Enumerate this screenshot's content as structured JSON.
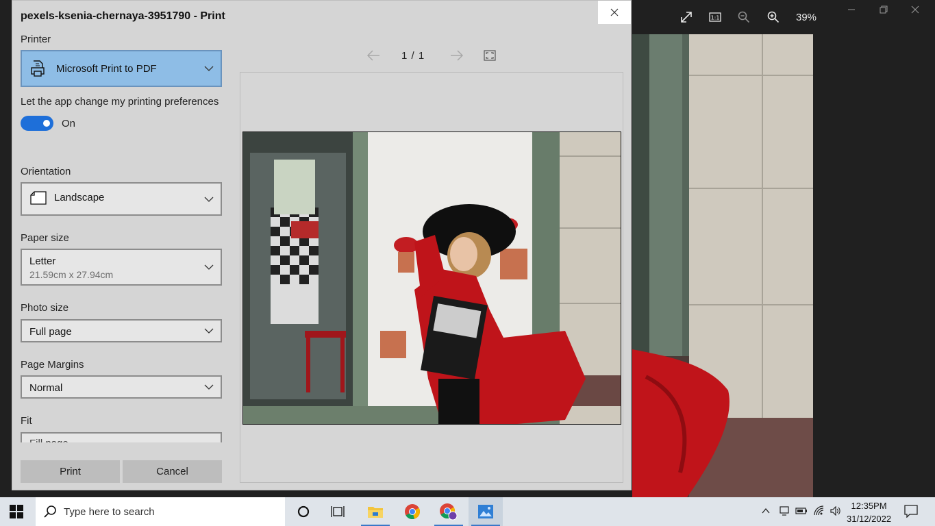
{
  "photos_app": {
    "zoom": "39%",
    "toolbar_icons": [
      "expand-icon",
      "actual-size-icon",
      "zoom-out-icon",
      "zoom-in-icon"
    ],
    "window_controls": [
      "minimize-icon",
      "restore-icon",
      "close-icon"
    ]
  },
  "dialog": {
    "title": "pexels-ksenia-chernaya-3951790 - Print",
    "printer": {
      "label": "Printer",
      "value": "Microsoft Print to PDF"
    },
    "preferences": {
      "label": "Let the app change my printing preferences",
      "toggle_text": "On",
      "enabled": true
    },
    "orientation": {
      "label": "Orientation",
      "value": "Landscape"
    },
    "paper_size": {
      "label": "Paper size",
      "value": "Letter",
      "detail": "21.59cm x 27.94cm"
    },
    "photo_size": {
      "label": "Photo size",
      "value": "Full page"
    },
    "page_margins": {
      "label": "Page Margins",
      "value": "Normal"
    },
    "fit": {
      "label": "Fit",
      "value": "Fill page"
    },
    "print_label": "Print",
    "cancel_label": "Cancel",
    "preview": {
      "page_indicator": "1 / 1"
    }
  },
  "taskbar": {
    "search_placeholder": "Type here to search",
    "apps": [
      "cortana-icon",
      "task-view-icon",
      "file-explorer-icon",
      "chrome-icon",
      "chrome-profile-icon",
      "photos-icon"
    ],
    "time": "12:35PM",
    "date": "31/12/2022"
  },
  "colors": {
    "accent": "#1e6fd9",
    "selected_printer_bg": "#8ebde6",
    "dress_red": "#c0141a"
  }
}
